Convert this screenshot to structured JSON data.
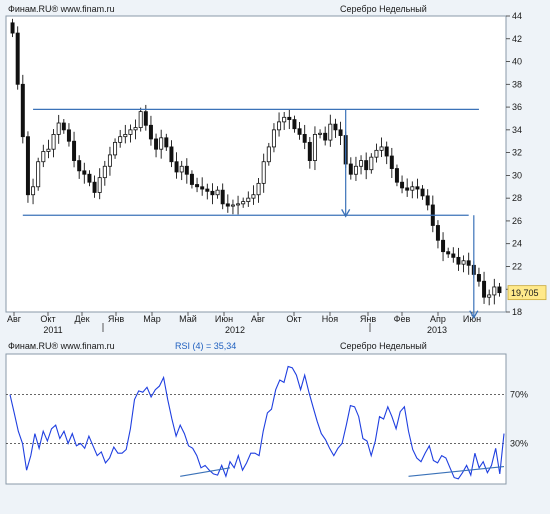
{
  "chart_data": [
    {
      "type": "candlestick",
      "header_left": "Финам.RU®  www.finam.ru",
      "header_right": "Серебро Недельный",
      "ylim": [
        18,
        44
      ],
      "y_ticks": [
        "18",
        "20",
        "22",
        "24",
        "26",
        "28",
        "30",
        "32",
        "34",
        "36",
        "38",
        "40",
        "42",
        "44"
      ],
      "month_labels": [
        "Авг",
        "Окт",
        "Дек",
        "Янв",
        "Мар",
        "Май",
        "Июн",
        "Авг",
        "Окт",
        "Ноя",
        "Янв",
        "Фев",
        "Апр",
        "Июн"
      ],
      "year_labels": [
        "2011",
        "2012",
        "2013"
      ],
      "last_price": "19,705",
      "colors": {
        "up": "#ffffff",
        "down": "#111111",
        "trend": "#3b72b8",
        "badge": "#ffe98a",
        "frame": "#8a9aa8"
      },
      "trend_lines": [
        {
          "from": {
            "x": 4,
            "y": 35.8
          },
          "to": {
            "x": 91,
            "y": 35.8
          }
        },
        {
          "from": {
            "x": 2,
            "y": 26.5
          },
          "to": {
            "x": 89,
            "y": 26.5
          }
        },
        {
          "from": {
            "x": 65,
            "y": 35.8
          },
          "to": {
            "x": 65,
            "y": 26.4
          },
          "arrow": true
        },
        {
          "from": {
            "x": 90,
            "y": 26.5
          },
          "to": {
            "x": 90,
            "y": 17.5
          },
          "arrow": true
        }
      ],
      "close": [
        42.5,
        38.0,
        33.4,
        28.3,
        29.0,
        31.2,
        32.1,
        32.3,
        33.6,
        34.6,
        34.0,
        33.0,
        31.3,
        30.4,
        30.1,
        29.4,
        28.5,
        29.8,
        30.8,
        31.8,
        32.9,
        33.4,
        33.6,
        34.0,
        34.2,
        35.6,
        34.4,
        33.2,
        32.3,
        33.3,
        32.5,
        31.2,
        30.3,
        30.8,
        30.1,
        29.2,
        29.0,
        28.8,
        28.6,
        28.3,
        28.7,
        27.5,
        27.3,
        27.4,
        27.5,
        27.7,
        28.0,
        28.3,
        29.3,
        31.2,
        32.5,
        34.0,
        34.7,
        35.1,
        34.9,
        34.1,
        33.6,
        32.9,
        31.3,
        33.6,
        33.7,
        33.1,
        34.5,
        34.0,
        33.5,
        31.0,
        30.1,
        30.8,
        31.3,
        30.5,
        31.6,
        32.2,
        32.5,
        31.7,
        30.6,
        29.4,
        28.9,
        28.7,
        29.0,
        28.8,
        28.2,
        27.4,
        25.6,
        24.3,
        23.3,
        23.1,
        22.8,
        22.2,
        22.5,
        22.1,
        21.3,
        20.7,
        19.3,
        19.5,
        20.2,
        19.7
      ],
      "rsi": {
        "label": "RSI (4) = 35,34",
        "header_left": "Финам.RU®  www.finam.ru",
        "header_right": "Серебро Недельный",
        "levels": [
          "70%",
          "30%"
        ],
        "level_values": [
          70,
          30
        ],
        "values": [
          70,
          55,
          40,
          30,
          8,
          20,
          38,
          26,
          40,
          32,
          42,
          45,
          34,
          40,
          30,
          38,
          28,
          30,
          26,
          36,
          28,
          20,
          23,
          14,
          18,
          27,
          22,
          22,
          25,
          42,
          66,
          73,
          72,
          76,
          68,
          74,
          77,
          84,
          66,
          50,
          36,
          45,
          38,
          28,
          26,
          20,
          10,
          12,
          8,
          5,
          4,
          12,
          3,
          15,
          10,
          20,
          8,
          14,
          22,
          22,
          20,
          40,
          55,
          58,
          74,
          82,
          80,
          93,
          92,
          86,
          74,
          86,
          72,
          60,
          48,
          38,
          33,
          26,
          20,
          26,
          30,
          45,
          61,
          60,
          52,
          34,
          32,
          20,
          32,
          52,
          50,
          60,
          52,
          42,
          56,
          60,
          40,
          25,
          18,
          15,
          22,
          28,
          16,
          14,
          20,
          18,
          10,
          2,
          1,
          6,
          12,
          4,
          22,
          10,
          15,
          6,
          12,
          26,
          5,
          38
        ],
        "trend_lines": [
          {
            "from": {
              "x": 41,
              "y": 3
            },
            "to": {
              "x": 53,
              "y": 10
            }
          },
          {
            "from": {
              "x": 96,
              "y": 3
            },
            "to": {
              "x": 119,
              "y": 11
            }
          }
        ]
      }
    }
  ]
}
